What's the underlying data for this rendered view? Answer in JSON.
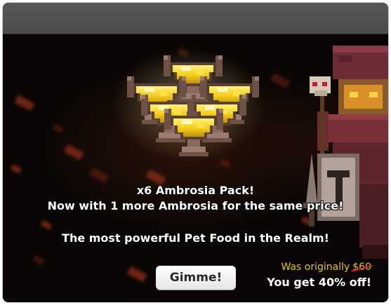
{
  "offer": {
    "title": "x6 Ambrosia Pack!",
    "subtitle": "Now with 1 more Ambrosia for the same price!",
    "tagline": "The most powerful Pet Food in the Realm!",
    "button_label": "Gimme!",
    "was_prefix": "Was originally",
    "was_price": "$60",
    "discount_text": "You get 40% off!"
  },
  "colors": {
    "title_bar": "#4f4f4f",
    "background": "#0a0605",
    "gold_text": "#e2c227",
    "strike": "#d2231a",
    "ember": "#a2331a"
  },
  "icons": {
    "ambrosia": "ambrosia-chalice-icon",
    "character": "pixel-adventurer-sprite"
  }
}
